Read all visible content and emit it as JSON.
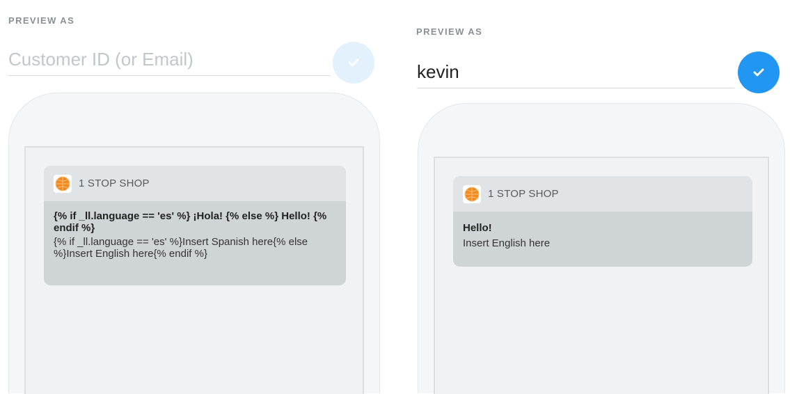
{
  "left_panel": {
    "section_label": "PREVIEW AS",
    "customer_input": {
      "value": "",
      "placeholder": "Customer ID (or Email)"
    },
    "confirm_button": {
      "icon": "checkmark-icon",
      "state": "disabled",
      "color": "#e3f1fc"
    },
    "notification": {
      "app_icon": "app-logo-icon",
      "app_name": "1 STOP SHOP",
      "title": "{% if _ll.language == 'es' %} ¡Hola! {% else %} Hello! {% endif %}",
      "body": "{% if _ll.language == 'es' %}Insert Spanish here{% else %}Insert English here{% endif %}"
    }
  },
  "right_panel": {
    "section_label": "PREVIEW AS",
    "customer_input": {
      "value": "kevin",
      "placeholder": "Customer ID (or Email)"
    },
    "confirm_button": {
      "icon": "checkmark-icon",
      "state": "enabled",
      "color": "#2196f3"
    },
    "notification": {
      "app_icon": "app-logo-icon",
      "app_name": "1 STOP SHOP",
      "title": "Hello!",
      "body": "Insert English here"
    }
  }
}
